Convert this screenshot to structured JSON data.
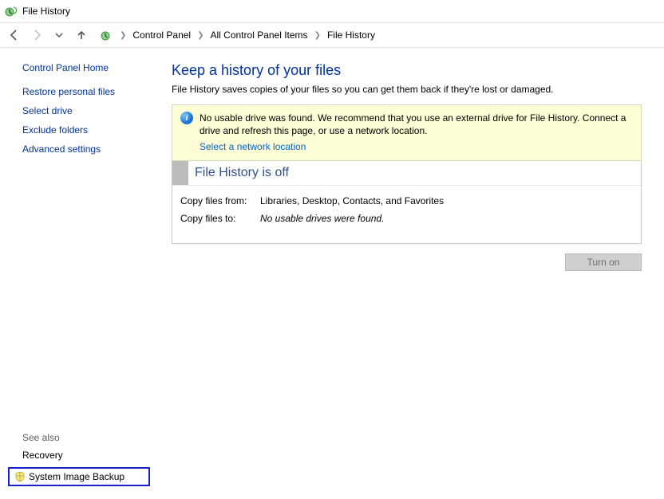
{
  "window": {
    "title": "File History"
  },
  "breadcrumb": {
    "items": [
      "Control Panel",
      "All Control Panel Items",
      "File History"
    ]
  },
  "sidebar": {
    "home": "Control Panel Home",
    "links": [
      "Restore personal files",
      "Select drive",
      "Exclude folders",
      "Advanced settings"
    ],
    "see_also_label": "See also",
    "see_also": [
      "Recovery",
      "System Image Backup"
    ]
  },
  "main": {
    "title": "Keep a history of your files",
    "description": "File History saves copies of your files so you can get them back if they're lost or damaged.",
    "warning": {
      "text": "No usable drive was found. We recommend that you use an external drive for File History. Connect a drive and refresh this page, or use a network location.",
      "link": "Select a network location"
    },
    "status": {
      "title": "File History is off",
      "copy_from_label": "Copy files from:",
      "copy_from_value": "Libraries, Desktop, Contacts, and Favorites",
      "copy_to_label": "Copy files to:",
      "copy_to_value": "No usable drives were found."
    },
    "turn_on_label": "Turn on"
  }
}
